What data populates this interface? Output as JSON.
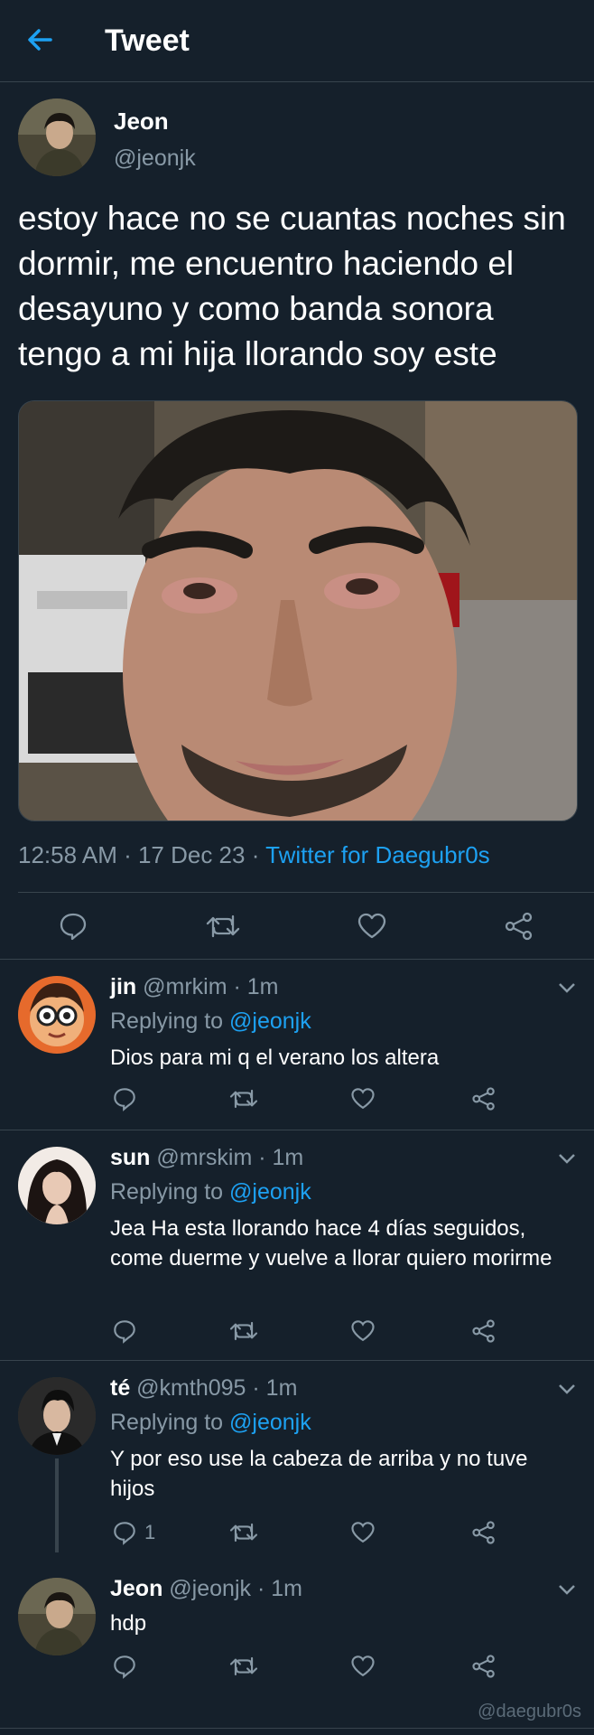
{
  "header": {
    "title": "Tweet"
  },
  "main_tweet": {
    "name": "Jeon",
    "handle": "@jeonjk",
    "text": "estoy hace no se cuantas noches sin dormir, me encuentro haciendo el desayuno y como banda sonora tengo a mi hija llorando soy este",
    "time": "12:58 AM · 17 Dec 23 · ",
    "source": "Twitter for Daegubr0s"
  },
  "replies": [
    {
      "name": "jin",
      "meta": " @mrkim · 1m",
      "replying": "Replying to ",
      "mention": "@jeonjk",
      "text": "Dios para mi q el verano los altera",
      "reply_count": ""
    },
    {
      "name": "sun",
      "meta": " @mrskim · 1m",
      "replying": "Replying to ",
      "mention": "@jeonjk",
      "text": "Jea Ha esta llorando hace 4 días seguidos, come duerme y vuelve a llorar quiero morirme",
      "reply_count": ""
    },
    {
      "name": "té",
      "meta": " @kmth095 · 1m",
      "replying": "Replying to ",
      "mention": "@jeonjk",
      "text": "Y por eso use la cabeza de arriba y no tuve hijos",
      "reply_count": "1"
    },
    {
      "name": "Jeon",
      "meta": " @jeonjk · 1m",
      "text": "hdp",
      "reply_count": ""
    }
  ],
  "watermark": "@daegubr0s",
  "colors": {
    "background": "#15202b",
    "accent": "#1da1f2",
    "muted": "#8899a6",
    "border": "#38444d"
  }
}
